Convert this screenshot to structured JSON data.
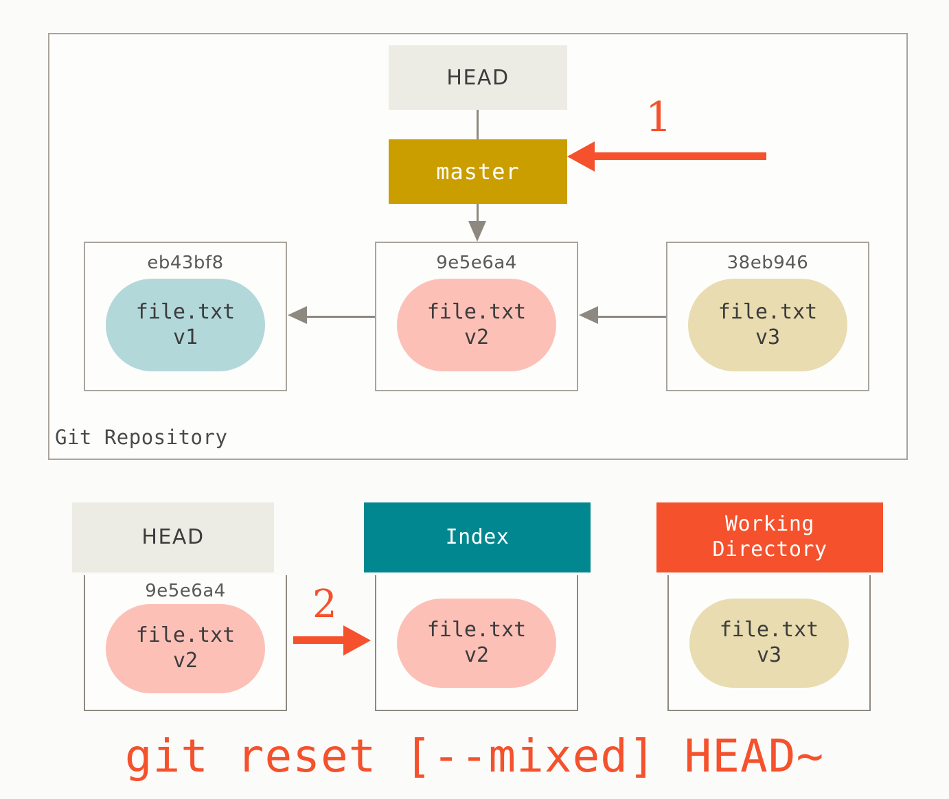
{
  "colors": {
    "background": "#fbfbf9",
    "accent_red": "#f4512c",
    "branch_gold": "#cb9e00",
    "index_teal": "#00878f",
    "working_dir_orange": "#f4512c",
    "head_gray": "#ecece4",
    "border_gray": "#8d8980",
    "blob_v1_blue": "#b2d8da",
    "blob_v2_pink": "#fcc0b7",
    "blob_v3_khaki": "#e8dcb0"
  },
  "repository": {
    "label": "Git Repository",
    "head_pointer": {
      "label": "HEAD"
    },
    "branch": {
      "label": "master"
    },
    "commits": [
      {
        "sha": "eb43bf8",
        "file": "file.txt",
        "version": "v1",
        "blob_class": "blob-v1"
      },
      {
        "sha": "9e5e6a4",
        "file": "file.txt",
        "version": "v2",
        "blob_class": "blob-v2"
      },
      {
        "sha": "38eb946",
        "file": "file.txt",
        "version": "v3",
        "blob_class": "blob-v3"
      }
    ]
  },
  "annotations": {
    "step_one": "1",
    "step_two": "2"
  },
  "trees": {
    "head": {
      "header": "HEAD",
      "sha": "9e5e6a4",
      "file": "file.txt",
      "version": "v2"
    },
    "index": {
      "header_line1": "Index",
      "header_line2": "",
      "file": "file.txt",
      "version": "v2"
    },
    "working_directory": {
      "header_line1": "Working",
      "header_line2": "Directory",
      "file": "file.txt",
      "version": "v3"
    }
  },
  "caption": {
    "command": "git reset [--mixed] HEAD~"
  }
}
